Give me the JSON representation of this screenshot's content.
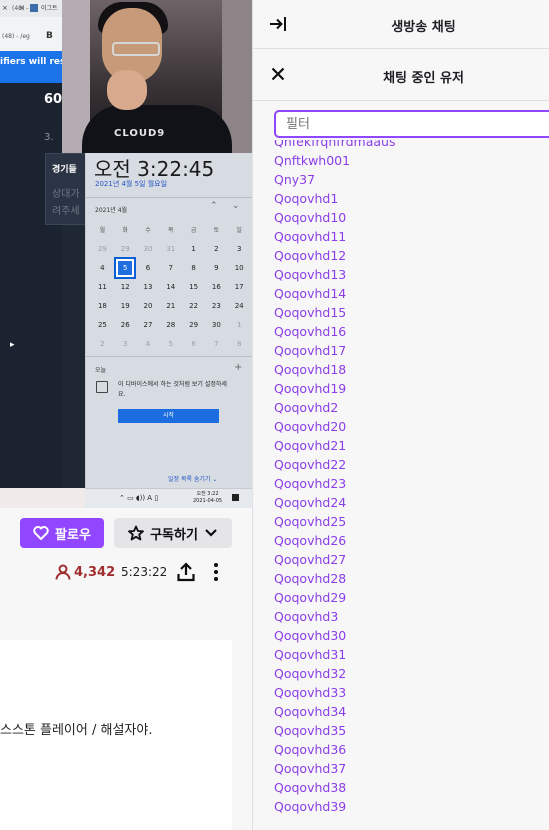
{
  "browser": {
    "tabs": [
      {
        "label": "(48) - Jeg",
        "close": "×"
      },
      {
        "label": "이그트",
        "close": "×"
      }
    ],
    "url_fragment": "(48) - /eg",
    "bookmark_letter": "B",
    "banner_text": "ifiers will resu"
  },
  "stream_content": {
    "heading": "60",
    "list_number": "3.",
    "card_title": "경기들",
    "card_body": [
      "상대가",
      "려주세"
    ],
    "webcam_logo": "CLOUD9"
  },
  "windows_calendar": {
    "time": "오전 3:22:45",
    "date": "2021년 4월 5일 월요일",
    "month_label": "2021년 4월",
    "nav_up": "⌃",
    "nav_down": "⌄",
    "weekday_headers": [
      "월",
      "화",
      "수",
      "목",
      "금",
      "토",
      "일"
    ],
    "weeks": [
      [
        {
          "d": "29",
          "dim": true
        },
        {
          "d": "29",
          "dim": true
        },
        {
          "d": "30",
          "dim": true
        },
        {
          "d": "31",
          "dim": true
        },
        {
          "d": "1"
        },
        {
          "d": "2"
        },
        {
          "d": "3"
        }
      ],
      [
        {
          "d": "4"
        },
        {
          "d": "5",
          "today": true
        },
        {
          "d": "6"
        },
        {
          "d": "7"
        },
        {
          "d": "8"
        },
        {
          "d": "9"
        },
        {
          "d": "10"
        }
      ],
      [
        {
          "d": "11"
        },
        {
          "d": "12"
        },
        {
          "d": "13"
        },
        {
          "d": "14"
        },
        {
          "d": "15"
        },
        {
          "d": "16"
        },
        {
          "d": "17"
        }
      ],
      [
        {
          "d": "18"
        },
        {
          "d": "19"
        },
        {
          "d": "20"
        },
        {
          "d": "21"
        },
        {
          "d": "22"
        },
        {
          "d": "23"
        },
        {
          "d": "24"
        }
      ],
      [
        {
          "d": "25"
        },
        {
          "d": "26"
        },
        {
          "d": "27"
        },
        {
          "d": "28"
        },
        {
          "d": "29"
        },
        {
          "d": "30"
        },
        {
          "d": "1",
          "dim": true
        }
      ],
      [
        {
          "d": "2",
          "dim": true
        },
        {
          "d": "3",
          "dim": true
        },
        {
          "d": "4",
          "dim": true
        },
        {
          "d": "5",
          "dim": true
        },
        {
          "d": "6",
          "dim": true
        },
        {
          "d": "7",
          "dim": true
        },
        {
          "d": "8",
          "dim": true
        }
      ]
    ],
    "today_label": "오늘",
    "add_event": "+",
    "event_text": "이 디바이스에서 하는 것처럼 보기 설정하세요.",
    "start_button": "시작",
    "hide_agenda": "일정 목록 숨기기 ⌄",
    "taskbar_icons": "⌃ ▭ ◖)) A ▯",
    "taskbar_time": "오전 3:22",
    "taskbar_date": "2021-04-05"
  },
  "channel_actions": {
    "follow_label": "팔로우",
    "subscribe_label": "구독하기",
    "viewer_count": "4,342",
    "uptime": "5:23:22"
  },
  "about": {
    "text": "스스톤 플레이어 / 해설자야."
  },
  "chat": {
    "title": "생방송 채팅",
    "users_title": "채팅 중인 유저",
    "filter_placeholder": "필터",
    "users": [
      "Qnfekfrqnfrdmaaus",
      "Qnftkwh001",
      "Qny37",
      "Qoqovhd1",
      "Qoqovhd10",
      "Qoqovhd11",
      "Qoqovhd12",
      "Qoqovhd13",
      "Qoqovhd14",
      "Qoqovhd15",
      "Qoqovhd16",
      "Qoqovhd17",
      "Qoqovhd18",
      "Qoqovhd19",
      "Qoqovhd2",
      "Qoqovhd20",
      "Qoqovhd21",
      "Qoqovhd22",
      "Qoqovhd23",
      "Qoqovhd24",
      "Qoqovhd25",
      "Qoqovhd26",
      "Qoqovhd27",
      "Qoqovhd28",
      "Qoqovhd29",
      "Qoqovhd3",
      "Qoqovhd30",
      "Qoqovhd31",
      "Qoqovhd32",
      "Qoqovhd33",
      "Qoqovhd34",
      "Qoqovhd35",
      "Qoqovhd36",
      "Qoqovhd37",
      "Qoqovhd38",
      "Qoqovhd39"
    ]
  },
  "colors": {
    "accent": "#9147ff",
    "username": "#8b3ee8",
    "viewer_red": "#a02e2e"
  },
  "icons": {
    "collapse": "arrow-right-to-line-icon",
    "close": "close-icon",
    "heart": "heart-icon",
    "star": "star-icon",
    "chevron": "chevron-down-icon",
    "person": "person-icon",
    "share": "share-icon",
    "more": "more-vertical-icon"
  }
}
